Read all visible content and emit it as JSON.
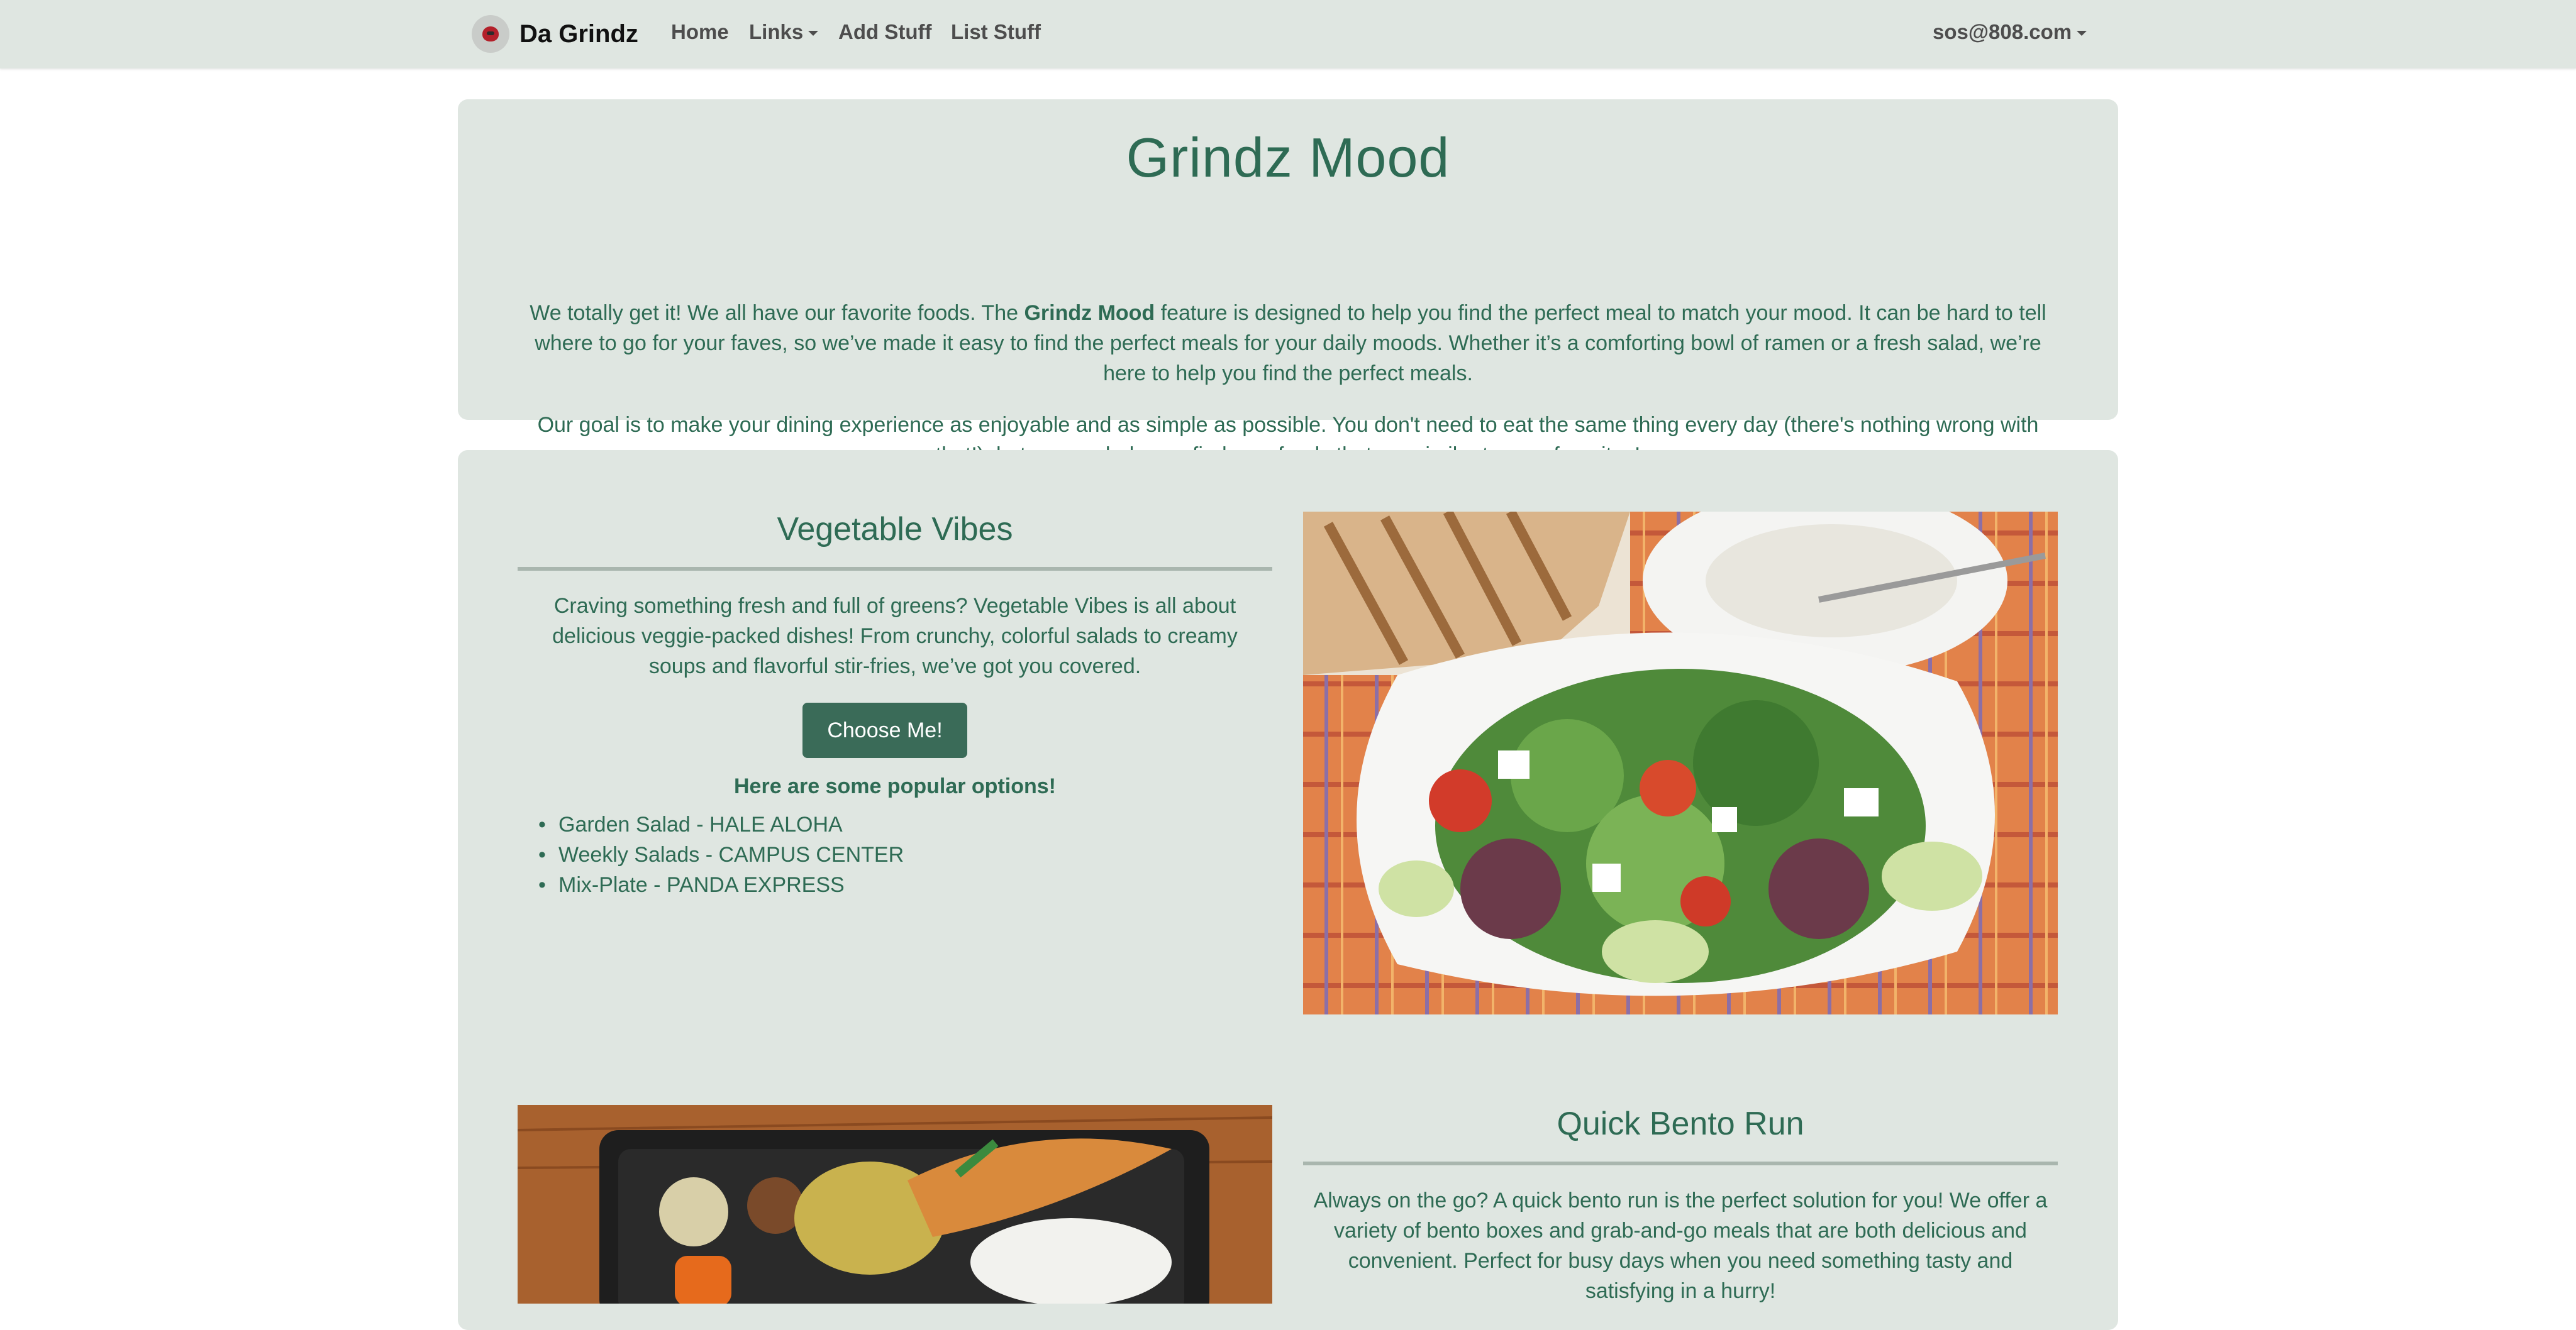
{
  "navbar": {
    "brand": "Da Grindz",
    "items": [
      "Home",
      "Links",
      "Add Stuff",
      "List Stuff"
    ],
    "user": "sos@808.com"
  },
  "intro": {
    "title": "Grindz Mood",
    "p1_before": "We totally get it! We all have our favorite foods. The ",
    "p1_bold": "Grindz Mood",
    "p1_after": " feature is designed to help you find the perfect meal to match your mood. It can be hard to tell where to go for your faves, so we’ve made it easy to find the perfect meals for your daily moods. Whether it’s a comforting bowl of ramen or a fresh salad, we’re here to help you find the perfect meals.",
    "p2": "Our goal is to make your dining experience as enjoyable and as simple as possible. You don't need to eat the same thing every day (there's nothing wrong with that!), but we can help you find new foods that are similar to your favorites!"
  },
  "vegetable": {
    "title": "Vegetable Vibes",
    "text": "Craving something fresh and full of greens? Vegetable Vibes is all about delicious veggie-packed dishes! From crunchy, colorful salads to creamy soups and flavorful stir-fries, we’ve got you covered.",
    "button": "Choose Me!",
    "popular": "Here are some popular options!",
    "options": [
      "Garden Salad - HALE ALOHA",
      "Weekly Salads - CAMPUS CENTER",
      "Mix-Plate - PANDA EXPRESS"
    ]
  },
  "bento": {
    "title": "Quick Bento Run",
    "text": "Always on the go? A quick bento run is the perfect solution for you! We offer a variety of bento boxes and grab-and-go meals that are both delicious and convenient. Perfect for busy days when you need something tasty and satisfying in a hurry!"
  }
}
